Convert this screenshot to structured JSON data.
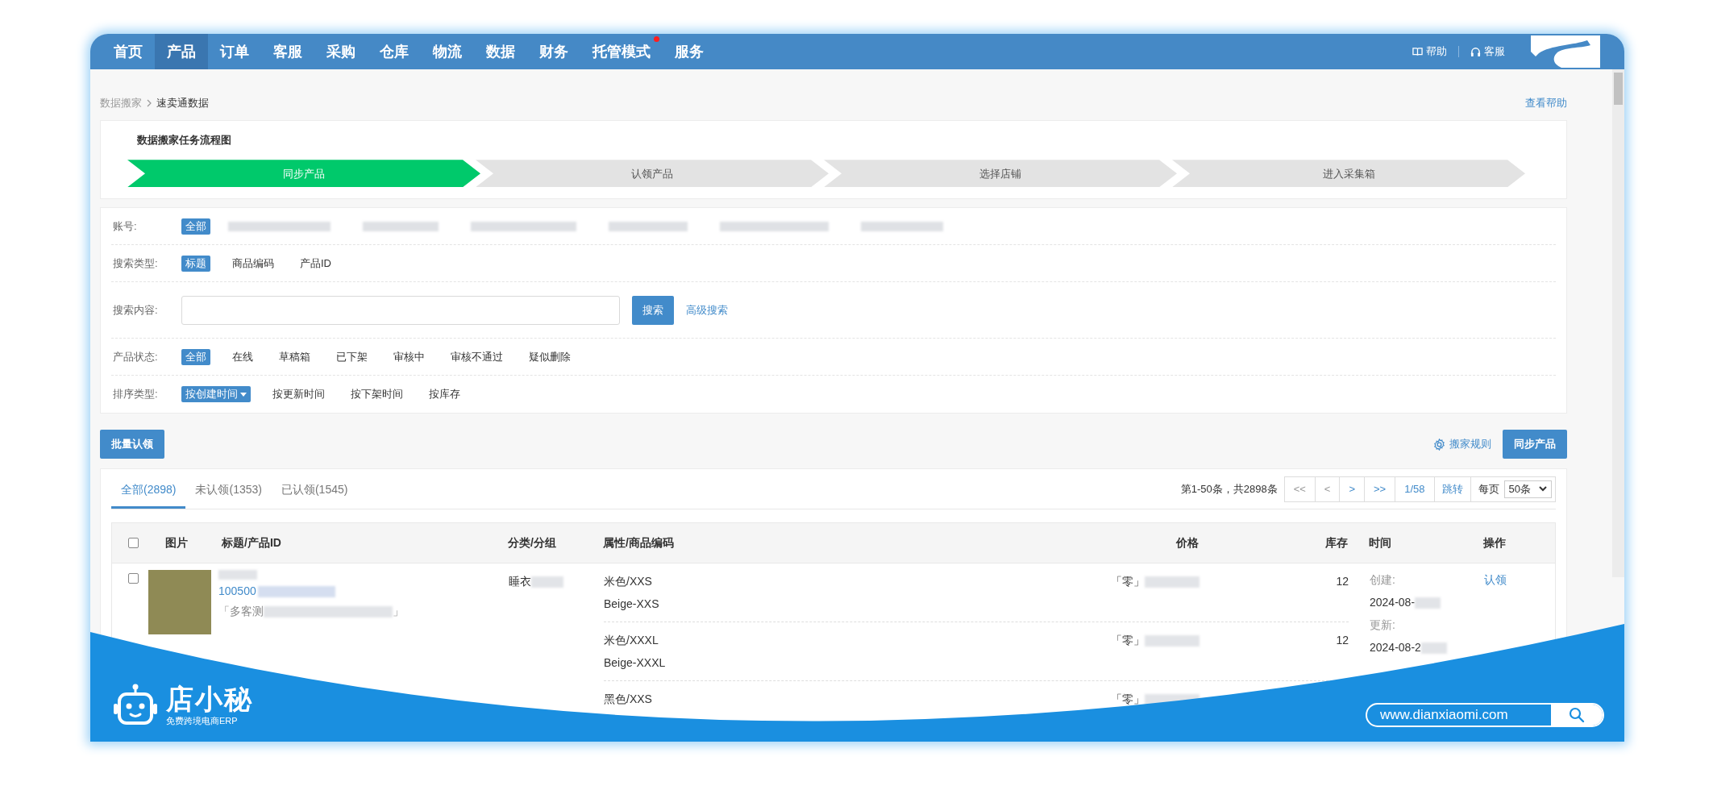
{
  "nav": {
    "items": [
      {
        "label": "首页",
        "selected": false,
        "dot": false
      },
      {
        "label": "产品",
        "selected": true,
        "dot": false
      },
      {
        "label": "订单",
        "selected": false,
        "dot": false
      },
      {
        "label": "客服",
        "selected": false,
        "dot": false
      },
      {
        "label": "采购",
        "selected": false,
        "dot": false
      },
      {
        "label": "仓库",
        "selected": false,
        "dot": false
      },
      {
        "label": "物流",
        "selected": false,
        "dot": false
      },
      {
        "label": "数据",
        "selected": false,
        "dot": false
      },
      {
        "label": "财务",
        "selected": false,
        "dot": false
      },
      {
        "label": "托管模式",
        "selected": false,
        "dot": true
      },
      {
        "label": "服务",
        "selected": false,
        "dot": false
      }
    ],
    "help": "帮助",
    "support": "客服"
  },
  "breadcrumb": {
    "items": [
      "数据搬家",
      "速卖通数据"
    ],
    "help_link": "查看帮助"
  },
  "flow": {
    "title": "数据搬家任务流程图",
    "steps": [
      {
        "label": "同步产品",
        "selected": true
      },
      {
        "label": "认领产品",
        "selected": false
      },
      {
        "label": "选择店铺",
        "selected": false
      },
      {
        "label": "进入采集箱",
        "selected": false
      }
    ]
  },
  "filters": [
    {
      "kind": "options",
      "label": "账号:",
      "options": [
        {
          "kind": "text",
          "label": "全部",
          "selected": true
        },
        {
          "kind": "redacted"
        },
        {
          "kind": "redacted"
        },
        {
          "kind": "redacted"
        },
        {
          "kind": "redacted"
        },
        {
          "kind": "redacted"
        },
        {
          "kind": "redacted"
        }
      ]
    },
    {
      "kind": "options",
      "label": "搜索类型:",
      "options": [
        {
          "kind": "text",
          "label": "标题",
          "selected": true
        },
        {
          "kind": "text",
          "label": "商品编码",
          "selected": false
        },
        {
          "kind": "text",
          "label": "产品ID",
          "selected": false
        }
      ]
    },
    {
      "kind": "search",
      "label": "搜索内容:",
      "button": "搜索",
      "link": "高级搜索"
    },
    {
      "kind": "options",
      "label": "产品状态:",
      "options": [
        {
          "kind": "text",
          "label": "全部",
          "selected": true
        },
        {
          "kind": "text",
          "label": "在线",
          "selected": false
        },
        {
          "kind": "text",
          "label": "草稿箱",
          "selected": false
        },
        {
          "kind": "text",
          "label": "已下架",
          "selected": false
        },
        {
          "kind": "text",
          "label": "审核中",
          "selected": false
        },
        {
          "kind": "text",
          "label": "审核不通过",
          "selected": false
        },
        {
          "kind": "text",
          "label": "疑似删除",
          "selected": false
        }
      ]
    },
    {
      "kind": "options",
      "label": "排序类型:",
      "options": [
        {
          "kind": "dropdown",
          "label": "按创建时间",
          "selected": true
        },
        {
          "kind": "text",
          "label": "按更新时间",
          "selected": false
        },
        {
          "kind": "text",
          "label": "按下架时间",
          "selected": false
        },
        {
          "kind": "text",
          "label": "按库存",
          "selected": false
        }
      ]
    }
  ],
  "toolbar": {
    "batch_button": "批量认领",
    "rules_link": "搬家规则",
    "sync_button": "同步产品"
  },
  "tabs": [
    {
      "label": "全部(2898)",
      "selected": true
    },
    {
      "label": "未认领(1353)",
      "selected": false
    },
    {
      "label": "已认领(1545)",
      "selected": false
    }
  ],
  "pagination": {
    "summary": "第1-50条，共2898条",
    "buttons": [
      {
        "label": "<<",
        "disabled": true
      },
      {
        "label": "<",
        "disabled": true
      },
      {
        "label": ">",
        "disabled": false
      },
      {
        "label": ">>",
        "disabled": false
      }
    ],
    "page": "1/58",
    "jump": "跳转",
    "per_page_label": "每页",
    "per_page": "50条"
  },
  "table": {
    "all_checked": false,
    "columns": [
      "图片",
      "标题/产品ID",
      "分类/分组",
      "属性/商品编码",
      "价格",
      "库存",
      "时间",
      "操作"
    ],
    "rows": [
      {
        "checked": false,
        "product_id": "100500",
        "note": "「多客测",
        "note_end": "」",
        "category": "睡衣",
        "created_label": "创建:",
        "created": "2024-08-",
        "updated_label": "更新:",
        "updated": "2024-08-2",
        "action": "认领",
        "variants": [
          {
            "attr": "米色/XXS",
            "code": "Beige-XXS",
            "price": "「零」",
            "stock": "12"
          },
          {
            "attr": "米色/XXXL",
            "code": "Beige-XXXL",
            "price": "「零」",
            "stock": "12"
          },
          {
            "attr": "黑色/XXS",
            "price": "「零」"
          }
        ]
      }
    ]
  },
  "banner": {
    "brand": "店小秘",
    "tagline": "免费跨境电商ERP",
    "url": "www.dianxiaomi.com"
  }
}
